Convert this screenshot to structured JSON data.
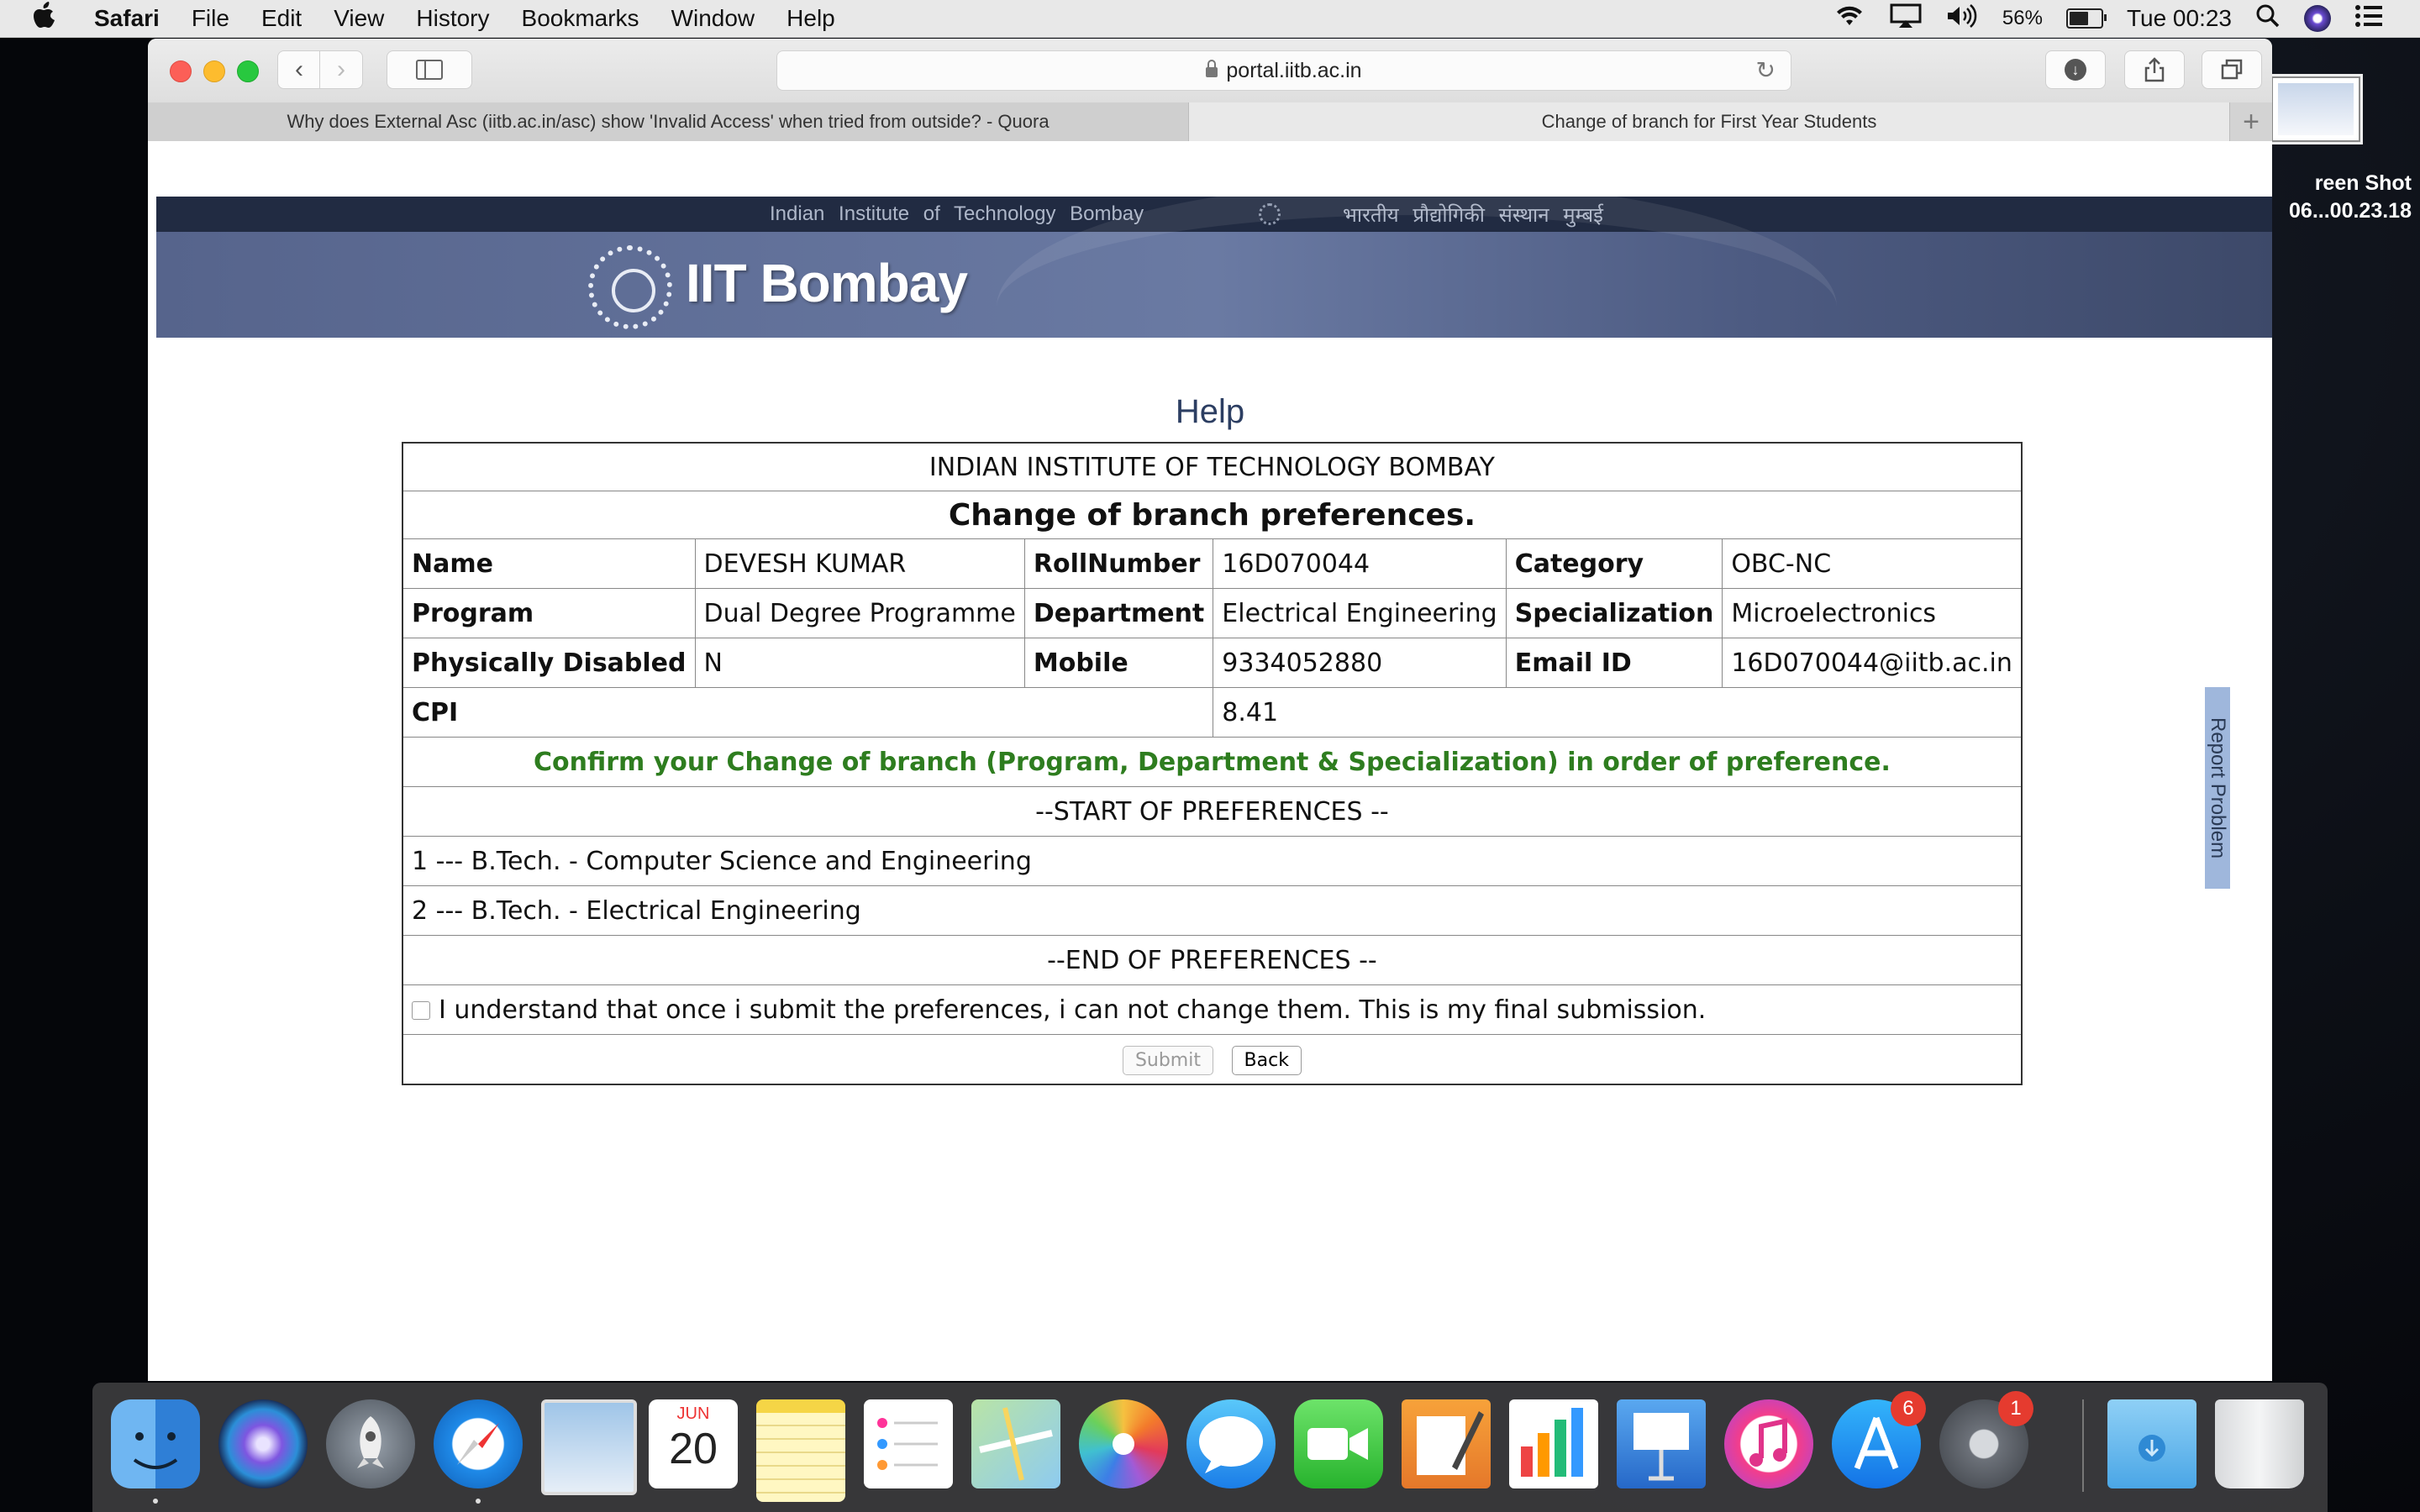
{
  "menubar": {
    "apple": "",
    "app": "Safari",
    "items": [
      "File",
      "Edit",
      "View",
      "History",
      "Bookmarks",
      "Window",
      "Help"
    ],
    "battery_label": "56%",
    "battery_level": 0.56,
    "clock": "Tue 00:23"
  },
  "browser": {
    "url": "portal.iitb.ac.in",
    "tabs": [
      {
        "title": "Why does External Asc (iitb.ac.in/asc) show 'Invalid Access' when tried from outside? - Quora"
      },
      {
        "title": "Change of branch for First Year Students"
      }
    ]
  },
  "banner": {
    "strip_en": "Indian Institute of Technology Bombay",
    "strip_hi": "भारतीय प्रौद्योगिकी संस्थान मुम्बई",
    "logo_text": "IIT Bombay"
  },
  "page": {
    "help_link": "Help",
    "institute": "INDIAN INSTITUTE OF TECHNOLOGY BOMBAY",
    "heading": "Change of branch preferences.",
    "fields": {
      "name_label": "Name",
      "name": "DEVESH KUMAR",
      "roll_label": "RollNumber",
      "roll": "16D070044",
      "category_label": "Category",
      "category": "OBC-NC",
      "program_label": "Program",
      "program": "Dual Degree Programme",
      "department_label": "Department",
      "department": "Electrical Engineering",
      "specialization_label": "Specialization",
      "specialization": "Microelectronics",
      "pd_label": "Physically Disabled",
      "pd": "N",
      "mobile_label": "Mobile",
      "mobile": "9334052880",
      "email_label": "Email ID",
      "email": "16D070044@iitb.ac.in",
      "cpi_label": "CPI",
      "cpi": "8.41"
    },
    "confirm_text": "Confirm your Change of branch (Program, Department & Specialization) in order of preference.",
    "start_marker": "--START OF PREFERENCES --",
    "preferences": [
      "1 --- B.Tech. - Computer Science and Engineering",
      "2 --- B.Tech. - Electrical Engineering"
    ],
    "end_marker": "--END OF PREFERENCES --",
    "declaration": "I understand that once i submit the preferences, i can not change them. This is my final submission.",
    "submit_label": "Submit",
    "back_label": "Back",
    "report_problem": "Report Problem"
  },
  "desktop": {
    "screenshot_label_1": "reen Shot",
    "screenshot_label_2": "06...00.23.18"
  },
  "dock": {
    "calendar_month": "JUN",
    "calendar_day": "20",
    "appstore_badge": "6",
    "prefs_badge": "1"
  },
  "colors": {
    "accent_green": "#2e7d1f",
    "banner_dark": "#212b42",
    "banner_body": "#58678f",
    "help_link": "#2c3e62"
  }
}
